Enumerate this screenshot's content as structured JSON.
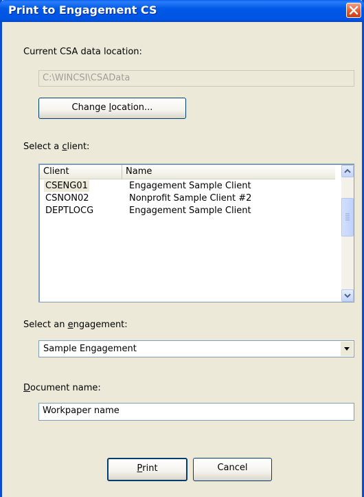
{
  "window": {
    "title": "Print to Engagement CS"
  },
  "data_location": {
    "label": "Current CSA data location:",
    "value": "C:\\WINCSI\\CSAData",
    "change_button": {
      "prefix": "Change ",
      "mnemonic": "l",
      "suffix": "ocation..."
    }
  },
  "client": {
    "label_prefix": "Select a ",
    "label_mnemonic": "c",
    "label_suffix": "lient:",
    "columns": [
      "Client",
      "Name"
    ],
    "rows": [
      {
        "code": "CSENG01",
        "name": "Engagement Sample Client",
        "selected": true
      },
      {
        "code": "CSNON02",
        "name": "Nonprofit Sample Client #2",
        "selected": false
      },
      {
        "code": "DEPTLOCG",
        "name": "Engagement Sample Client",
        "selected": false
      }
    ]
  },
  "engagement": {
    "label_prefix": "Select an ",
    "label_mnemonic": "e",
    "label_suffix": "ngagement:",
    "value": "Sample Engagement"
  },
  "document": {
    "label_mnemonic": "D",
    "label_suffix": "ocument name:",
    "value": "Workpaper name"
  },
  "buttons": {
    "print": {
      "mnemonic": "P",
      "suffix": "rint"
    },
    "cancel": "Cancel"
  },
  "colors": {
    "titlebar": "#0054e3",
    "dialog_bg": "#ece9d8",
    "close_button": "#e35b30"
  },
  "icons": {
    "close": "close-icon",
    "scroll_up": "scroll-up-arrow-icon",
    "scroll_down": "scroll-down-arrow-icon",
    "dropdown": "dropdown-arrow-icon"
  }
}
